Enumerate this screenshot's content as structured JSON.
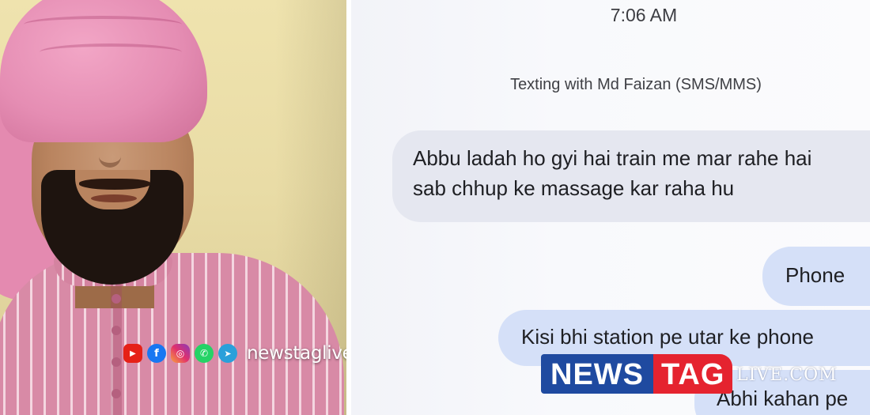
{
  "chat": {
    "time": "7:06 AM",
    "thread_info": "Texting with Md Faizan (SMS/MMS)",
    "incoming": {
      "line1": "Abbu ladah ho gyi hai train me mar rahe hai",
      "line2": "sab chhup ke massage kar raha hu"
    },
    "outgoing": [
      "Phone",
      "Kisi bhi station pe utar ke phone",
      "Abhi kahan pe"
    ]
  },
  "watermark": {
    "handle": "newstaglive",
    "social_icons": [
      "youtube-icon",
      "facebook-icon",
      "instagram-icon",
      "whatsapp-icon",
      "telegram-icon"
    ]
  },
  "logo": {
    "news": "NEWS",
    "tag": "TAG",
    "live": "LIVE.COM"
  },
  "colors": {
    "incoming_bubble": "#e5e7f0",
    "outgoing_bubble": "#d5e0f8",
    "logo_blue": "#1f4aa0",
    "logo_red": "#e5232f"
  }
}
